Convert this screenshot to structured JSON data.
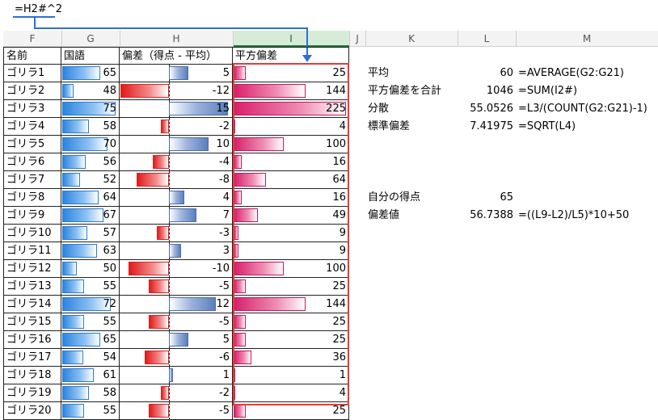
{
  "formula_bar": {
    "text": "=H2#^2"
  },
  "columns": [
    {
      "letter": "F",
      "selected": false
    },
    {
      "letter": "G",
      "selected": false
    },
    {
      "letter": "H",
      "selected": false
    },
    {
      "letter": "I",
      "selected": true
    },
    {
      "letter": "J",
      "selected": false
    },
    {
      "letter": "K",
      "selected": false
    },
    {
      "letter": "L",
      "selected": false
    },
    {
      "letter": "M",
      "selected": false
    }
  ],
  "table": {
    "headers": {
      "name": "名前",
      "kokugo": "国語",
      "hensa": "偏差（得点 - 平均）",
      "heihou": "平方偏差"
    },
    "rows": [
      {
        "name": "ゴリラ1",
        "score": 65,
        "dev": 5,
        "sq": 25
      },
      {
        "name": "ゴリラ2",
        "score": 48,
        "dev": -12,
        "sq": 144
      },
      {
        "name": "ゴリラ3",
        "score": 75,
        "dev": 15,
        "sq": 225
      },
      {
        "name": "ゴリラ4",
        "score": 58,
        "dev": -2,
        "sq": 4
      },
      {
        "name": "ゴリラ5",
        "score": 70,
        "dev": 10,
        "sq": 100
      },
      {
        "name": "ゴリラ6",
        "score": 56,
        "dev": -4,
        "sq": 16
      },
      {
        "name": "ゴリラ7",
        "score": 52,
        "dev": -8,
        "sq": 64
      },
      {
        "name": "ゴリラ8",
        "score": 64,
        "dev": 4,
        "sq": 16
      },
      {
        "name": "ゴリラ9",
        "score": 67,
        "dev": 7,
        "sq": 49
      },
      {
        "name": "ゴリラ10",
        "score": 57,
        "dev": -3,
        "sq": 9
      },
      {
        "name": "ゴリラ11",
        "score": 63,
        "dev": 3,
        "sq": 9
      },
      {
        "name": "ゴリラ12",
        "score": 50,
        "dev": -10,
        "sq": 100
      },
      {
        "name": "ゴリラ13",
        "score": 55,
        "dev": -5,
        "sq": 25
      },
      {
        "name": "ゴリラ14",
        "score": 72,
        "dev": 12,
        "sq": 144
      },
      {
        "name": "ゴリラ15",
        "score": 55,
        "dev": -5,
        "sq": 25
      },
      {
        "name": "ゴリラ16",
        "score": 65,
        "dev": 5,
        "sq": 25
      },
      {
        "name": "ゴリラ17",
        "score": 54,
        "dev": -6,
        "sq": 36
      },
      {
        "name": "ゴリラ18",
        "score": 61,
        "dev": 1,
        "sq": 1
      },
      {
        "name": "ゴリラ19",
        "score": 58,
        "dev": -2,
        "sq": 4
      },
      {
        "name": "ゴリラ20",
        "score": 55,
        "dev": -5,
        "sq": 25
      }
    ]
  },
  "stats": [
    {
      "label": "平均",
      "value": "60",
      "formula": "=AVERAGE(G2:G21)"
    },
    {
      "label": "平方偏差を合計",
      "value": "1046",
      "formula": "=SUM(I2#)"
    },
    {
      "label": "分散",
      "value": "55.0526",
      "formula": "=L3/(COUNT(G2:G21)-1)"
    },
    {
      "label": "標準偏差",
      "value": "7.41975",
      "formula": "=SQRT(L4)"
    },
    {
      "label": "",
      "value": "",
      "formula": ""
    },
    {
      "label": "",
      "value": "",
      "formula": ""
    },
    {
      "label": "",
      "value": "",
      "formula": ""
    },
    {
      "label": "自分の得点",
      "value": "65",
      "formula": ""
    },
    {
      "label": "偏差値",
      "value": "56.7388",
      "formula": "=((L9-L2)/L5)*10+50"
    }
  ],
  "colors": {
    "score_bar": "#2a84e0",
    "dev_positive": "#5a7fbd",
    "dev_negative": "#e21a1a",
    "sq_bar": "#d8206a",
    "highlight_box": "#e23c3c",
    "spill_arrow": "#2f6ed6",
    "selected_column": "#1b7a3a"
  }
}
